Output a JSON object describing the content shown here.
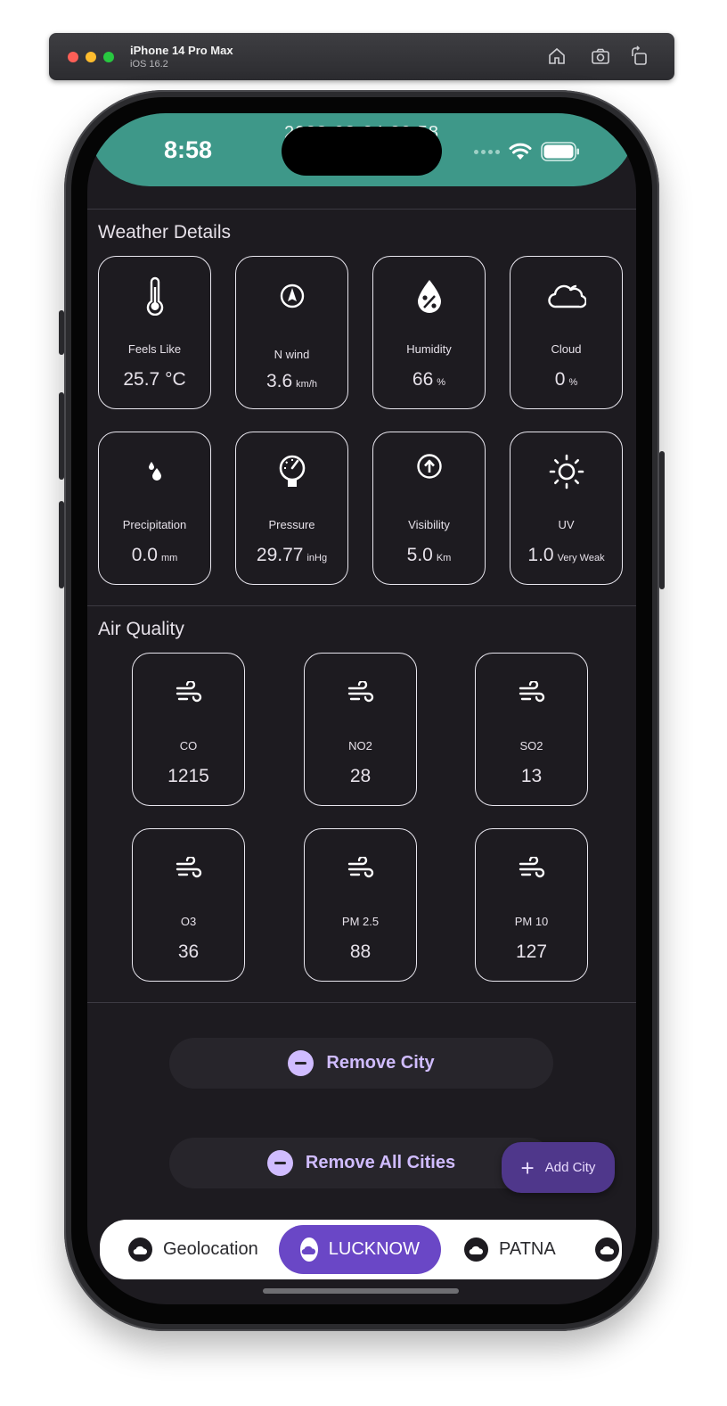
{
  "simulator": {
    "device": "iPhone 14 Pro Max",
    "os": "iOS 16.2",
    "icons": [
      "home-icon",
      "screenshot-icon",
      "rotate-icon"
    ]
  },
  "status_bar": {
    "time": "8:58"
  },
  "app_bar": {
    "title": "2023-03-24 20:58"
  },
  "weather_details": {
    "title": "Weather Details",
    "cards": [
      {
        "icon": "thermometer-icon",
        "label": "Feels Like",
        "value": "25.7 °C",
        "unit": ""
      },
      {
        "icon": "wind-direction-icon",
        "label": "N wind",
        "value": "3.6",
        "unit": "km/h"
      },
      {
        "icon": "humidity-icon",
        "label": "Humidity",
        "value": "66",
        "unit": "%"
      },
      {
        "icon": "cloud-icon",
        "label": "Cloud",
        "value": "0",
        "unit": "%"
      },
      {
        "icon": "precipitation-icon",
        "label": "Precipitation",
        "value": "0.0",
        "unit": "mm"
      },
      {
        "icon": "pressure-gauge-icon",
        "label": "Pressure",
        "value": "29.77",
        "unit": "inHg"
      },
      {
        "icon": "visibility-icon",
        "label": "Visibility",
        "value": "5.0",
        "unit": "Km"
      },
      {
        "icon": "sun-icon",
        "label": "UV",
        "value": "1.0",
        "unit": "Very Weak"
      }
    ]
  },
  "air_quality": {
    "title": "Air Quality",
    "cards": [
      {
        "icon": "wind-icon",
        "label": "CO",
        "value": "1215"
      },
      {
        "icon": "wind-icon",
        "label": "NO2",
        "value": "28"
      },
      {
        "icon": "wind-icon",
        "label": "SO2",
        "value": "13"
      },
      {
        "icon": "wind-icon",
        "label": "O3",
        "value": "36"
      },
      {
        "icon": "wind-icon",
        "label": "PM 2.5",
        "value": "88"
      },
      {
        "icon": "wind-icon",
        "label": "PM 10",
        "value": "127"
      }
    ]
  },
  "actions": {
    "remove_city": "Remove City",
    "remove_all_cities": "Remove All Cities",
    "add_city": "Add City"
  },
  "city_tabs": [
    {
      "label": "Geolocation",
      "selected": false
    },
    {
      "label": "LUCKNOW",
      "selected": true
    },
    {
      "label": "PATNA",
      "selected": false
    },
    {
      "label": "",
      "selected": false
    }
  ],
  "colors": {
    "app_bar": "#3e9889",
    "background": "#1d1b20",
    "accent": "#d0bcff",
    "fab": "#4f378b",
    "selected_tab": "#6a47c6"
  }
}
